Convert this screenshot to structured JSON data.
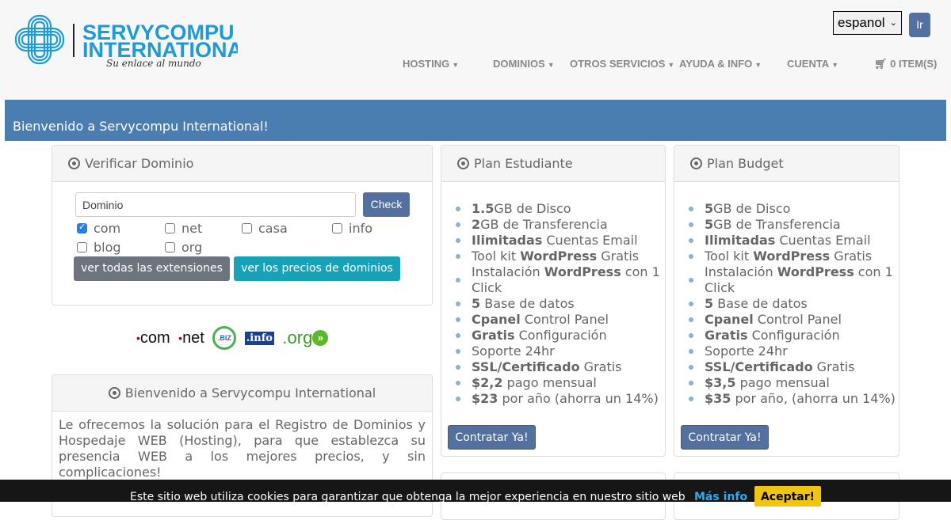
{
  "header": {
    "logo": {
      "line1": "SERVYCOMPU",
      "line2": "INTERNATIONAL",
      "tagline": "Su enlace al mundo"
    },
    "language": {
      "selected": "espanol",
      "go_label": "Ir"
    },
    "nav": [
      {
        "label": "HOSTING"
      },
      {
        "label": "DOMINIOS"
      },
      {
        "label": "OTROS SERVICIOS"
      },
      {
        "label": "AYUDA & INFO"
      },
      {
        "label": "CUENTA"
      }
    ],
    "cart": {
      "label": "0 ITEM(S)"
    }
  },
  "banner": {
    "title": "Bienvenido a Servycompu International!"
  },
  "domain_check": {
    "title": "Verificar Dominio",
    "input_value": "Dominio",
    "check_label": "Check",
    "extensions": [
      {
        "label": "com",
        "checked": true
      },
      {
        "label": "net",
        "checked": false
      },
      {
        "label": "casa",
        "checked": false
      },
      {
        "label": "info",
        "checked": false
      },
      {
        "label": "blog",
        "checked": false
      },
      {
        "label": "org",
        "checked": false
      }
    ],
    "all_extensions_label": "ver todas las extensiones",
    "prices_label": "ver los precios de dominios"
  },
  "tlds": {
    "com": "com",
    "net": "net",
    "biz": ".BIZ",
    "info": ".info",
    "org": ".org"
  },
  "welcome": {
    "title": "Bienvenido a Servycompu International",
    "text": "Le ofrecemos la solución para el Registro de Dominios y Hospedaje WEB (Hosting), para que establezca su presencia WEB a los mejores precios, y sin complicaciones!"
  },
  "plans": [
    {
      "title": "Plan Estudiante",
      "button": "Contratar Ya!",
      "features": [
        {
          "pre": "",
          "b": "1.5",
          "post": "GB de Disco"
        },
        {
          "pre": "",
          "b": "2",
          "post": "GB de Transferencia"
        },
        {
          "pre": "",
          "b": "Ilimitadas",
          "post": " Cuentas Email"
        },
        {
          "pre": "Tool kit ",
          "b": "WordPress",
          "post": " Gratis"
        },
        {
          "pre": "Instalación ",
          "b": "WordPress",
          "post": " con 1 Click"
        },
        {
          "pre": "",
          "b": "5",
          "post": " Base de datos"
        },
        {
          "pre": "",
          "b": "Cpanel",
          "post": " Control Panel"
        },
        {
          "pre": "",
          "b": "Gratis",
          "post": " Configuración"
        },
        {
          "pre": "Soporte 24hr",
          "b": "",
          "post": ""
        },
        {
          "pre": "",
          "b": "SSL/Certificado",
          "post": " Gratis"
        },
        {
          "pre": "",
          "b": "$2,2",
          "post": " pago mensual"
        },
        {
          "pre": "",
          "b": "$23",
          "post": " por año (ahorra un 14%)"
        }
      ]
    },
    {
      "title": "Plan Budget",
      "button": "Contratar Ya!",
      "features": [
        {
          "pre": "",
          "b": "5",
          "post": "GB de Disco"
        },
        {
          "pre": "",
          "b": "5",
          "post": "GB de Transferencia"
        },
        {
          "pre": "",
          "b": "Ilimitadas",
          "post": " Cuentas Email"
        },
        {
          "pre": "Tool kit ",
          "b": "WordPress",
          "post": " Gratis"
        },
        {
          "pre": "Instalación ",
          "b": "WordPress",
          "post": " con 1 Click"
        },
        {
          "pre": "",
          "b": "5",
          "post": " Base de datos"
        },
        {
          "pre": "",
          "b": "Cpanel",
          "post": " Control Panel"
        },
        {
          "pre": "",
          "b": "Gratis",
          "post": " Configuración"
        },
        {
          "pre": "Soporte 24hr",
          "b": "",
          "post": ""
        },
        {
          "pre": "",
          "b": "SSL/Certificado",
          "post": " Gratis"
        },
        {
          "pre": "",
          "b": "$3,5",
          "post": " pago mensual"
        },
        {
          "pre": "",
          "b": "$35",
          "post": " por año, (ahorra un 14%)"
        }
      ]
    }
  ],
  "cookie": {
    "text": "Este sitio web utiliza cookies para garantizar que obtenga la mejor experiencia en nuestro sitio web",
    "more": "Más info",
    "accept": "Aceptar!"
  },
  "colors": {
    "banner": "#4a7db0",
    "primary_button": "#53709e",
    "teal_button": "#17a2b8",
    "gray_button": "#6c757d",
    "brand": "#1e9ad6",
    "cookie_accept": "#f1c40f"
  }
}
